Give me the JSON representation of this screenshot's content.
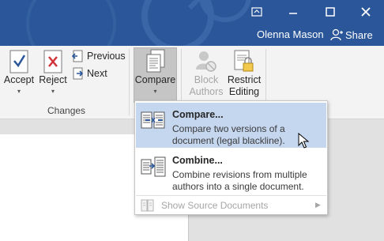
{
  "window": {
    "user_name": "Olenna Mason",
    "share_label": "Share",
    "accent": "#2b579a"
  },
  "ribbon": {
    "accept_label": "Accept",
    "reject_label": "Reject",
    "previous_label": "Previous",
    "next_label": "Next",
    "changes_group": "Changes",
    "compare_label": "Compare",
    "block_label_1": "Block",
    "block_label_2": "Authors",
    "restrict_label_1": "Restrict",
    "restrict_label_2": "Editing"
  },
  "menu": {
    "compare_title": "Compare...",
    "compare_desc": "Compare two versions of a document (legal blackline).",
    "combine_title": "Combine...",
    "combine_desc": "Combine revisions from multiple authors into a single document.",
    "show_source": "Show Source Documents"
  },
  "icons": [
    "restore-icon",
    "minimize-icon",
    "maximize-icon",
    "close-icon",
    "share-person-icon",
    "accept-icon",
    "reject-icon",
    "previous-icon",
    "next-icon",
    "compare-icon",
    "block-authors-icon",
    "restrict-editing-icon",
    "compare-menu-icon",
    "combine-menu-icon",
    "show-source-icon",
    "mouse-cursor-icon"
  ]
}
